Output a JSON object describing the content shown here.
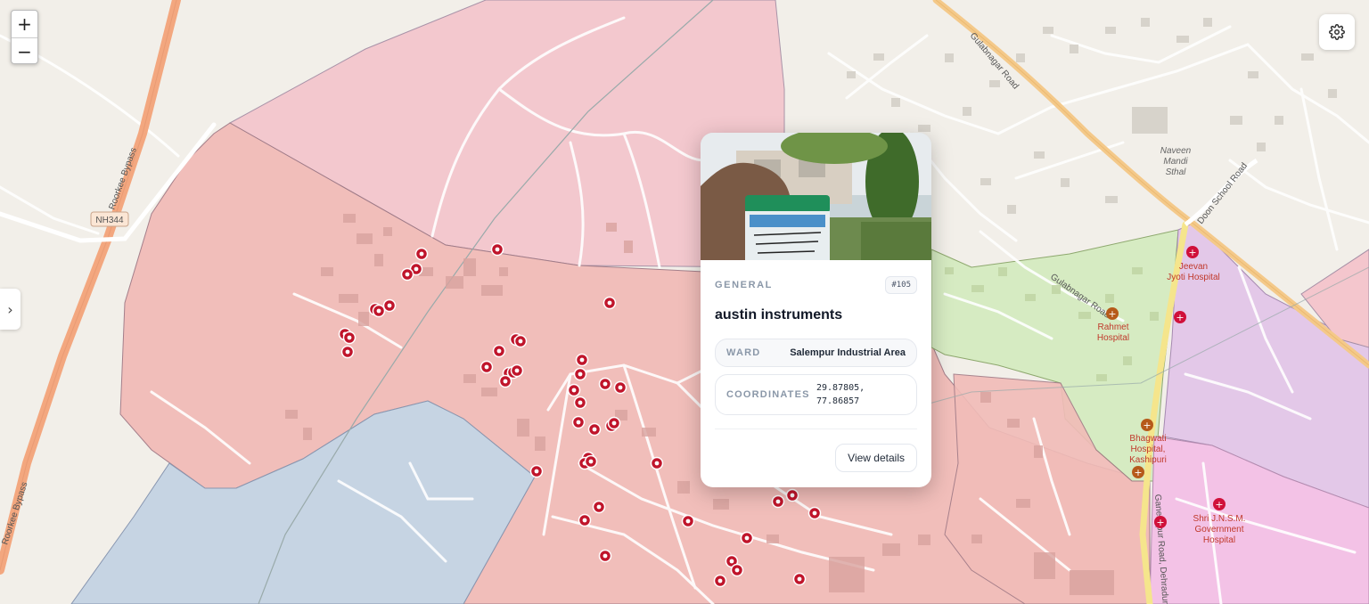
{
  "map": {
    "roads": {
      "bypass": "Roorkee Bypass",
      "bypass_partial": "Roorkee Bypass",
      "highway_shield": "NH344",
      "gulabnagar_road": "Gulabnagar Road",
      "doon_school_road": "Doon School Road",
      "ganeshpur_road": "Ganeshpur Road, Dehradun"
    },
    "places": {
      "naveen_mandi": [
        "Naveen",
        "Mandi",
        "Sthal"
      ],
      "jeevan_jyoti": [
        "Jeevan",
        "Jyoti Hospital"
      ],
      "rahmet": [
        "Rahmet",
        "Hospital"
      ],
      "bhagwati": [
        "Bhagwati",
        "Hospital,",
        "Kashipuri"
      ],
      "shri_jnsm": [
        "Shri J.N.S.M.",
        "Government",
        "Hospital"
      ]
    },
    "colors": {
      "ward_pink": "#f4c6cd",
      "ward_salmon": "#f1bcb8",
      "ward_blue": "#c6d4e3",
      "ward_green": "#d6ebc2",
      "ward_purple": "#e3c8e8",
      "ward_magenta": "#f3c2e6",
      "marker": "#c0152b",
      "hospital": "#d0103a"
    }
  },
  "controls": {
    "zoom_in": "+",
    "zoom_out": "−",
    "settings_icon": "gear-icon",
    "panel_toggle": "›"
  },
  "popup": {
    "category": "GENERAL",
    "id": "#105",
    "title": "austin instruments",
    "ward_label": "WARD",
    "ward_value": "Salempur Industrial Area",
    "coordinates_label": "COORDINATES",
    "latitude": "29.87805,",
    "longitude": "77.86857",
    "view_details": "View details"
  }
}
